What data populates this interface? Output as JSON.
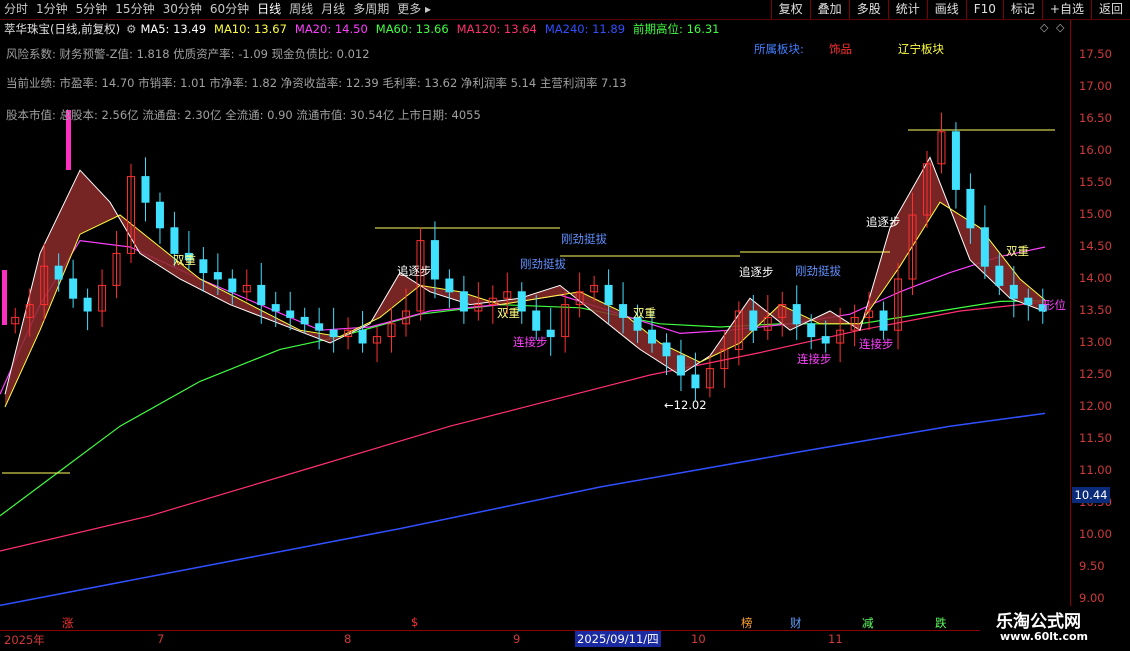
{
  "periods": [
    "分时",
    "1分钟",
    "5分钟",
    "15分钟",
    "30分钟",
    "60分钟",
    "日线",
    "周线",
    "月线",
    "多周期",
    "更多 ▸"
  ],
  "active_period": "日线",
  "tools": [
    "复权",
    "叠加",
    "多股",
    "统计",
    "画线",
    "F10",
    "标记",
    "+自选",
    "返回"
  ],
  "stock_title": "萃华珠宝(日线,前复权)",
  "ma": [
    {
      "label": "MA5: 13.49",
      "color": "#ffffff"
    },
    {
      "label": "MA10: 13.67",
      "color": "#ffff40"
    },
    {
      "label": "MA20: 14.50",
      "color": "#ff40ff"
    },
    {
      "label": "MA60: 13.66",
      "color": "#40ff40"
    },
    {
      "label": "MA120: 13.64",
      "color": "#ff3070"
    },
    {
      "label": "MA240: 11.89",
      "color": "#3050ff"
    },
    {
      "label": "前期高位: 16.31",
      "color": "#40ff40"
    }
  ],
  "info_lines": [
    "风险系数: 财务预警-Z值: 1.818 优质资产率: -1.09 现金负债比: 0.012",
    "当前业绩: 市盈率: 14.70 市销率: 1.01 市净率: 1.82 净资收益率: 12.39 毛利率: 13.62 净利润率 5.14 主营利润率 7.13",
    "股本市值: 总股本: 2.56亿 流通盘: 2.30亿 全流通: 0.90 流通市值: 30.54亿 上市日期: 4055"
  ],
  "sector_labels": [
    {
      "text": "所属板块:",
      "color": "#4080ff"
    },
    {
      "text": "饰品",
      "color": "#ff3030"
    },
    {
      "text": "辽宁板块",
      "color": "#ffff40"
    }
  ],
  "price_ticks": [
    "17.50",
    "17.00",
    "16.50",
    "16.00",
    "15.50",
    "15.00",
    "14.50",
    "14.00",
    "13.50",
    "13.00",
    "12.50",
    "12.00",
    "11.50",
    "11.00",
    "10.50",
    "10.00",
    "9.50",
    "9.00"
  ],
  "last_price": "10.44",
  "date_labels": [
    {
      "text": "2025年",
      "color": "#d03a3a"
    },
    {
      "text": "7",
      "color": "#d03a3a"
    },
    {
      "text": "8",
      "color": "#d03a3a"
    },
    {
      "text": "9",
      "color": "#d03a3a"
    },
    {
      "text": "10",
      "color": "#d03a3a"
    },
    {
      "text": "11",
      "color": "#d03a3a"
    }
  ],
  "selected_date": "2025/09/11/四",
  "bottom_marks": [
    {
      "text": "涨",
      "color": "#ff3030"
    },
    {
      "text": "$",
      "color": "#ff3030"
    },
    {
      "text": "榜",
      "color": "#ffa030"
    },
    {
      "text": "财",
      "color": "#60a0ff"
    },
    {
      "text": "减",
      "color": "#60ff60"
    },
    {
      "text": "跌",
      "color": "#60ff60"
    }
  ],
  "chart_annotations": [
    {
      "text": "双重",
      "color": "#ffff80"
    },
    {
      "text": "追逐步",
      "color": "#ffffff"
    },
    {
      "text": "刚劲挺拔",
      "color": "#6090ff"
    },
    {
      "text": "刚劲挺拔",
      "color": "#6090ff"
    },
    {
      "text": "双重",
      "color": "#ffff80"
    },
    {
      "text": "连接步",
      "color": "#ff40ff"
    },
    {
      "text": "双重",
      "color": "#ffff80"
    },
    {
      "text": "追逐步",
      "color": "#ffffff"
    },
    {
      "text": "刚劲挺拔",
      "color": "#6090ff"
    },
    {
      "text": "连接步",
      "color": "#ff40ff"
    },
    {
      "text": "追逐步",
      "color": "#ffffff"
    },
    {
      "text": "连接步",
      "color": "#ff40ff"
    },
    {
      "text": "双重",
      "color": "#ffff80"
    },
    {
      "text": "形位",
      "color": "#ff40ff"
    },
    {
      "text": "←12.02",
      "color": "#ffffff"
    }
  ],
  "watermark": {
    "line1": "乐淘公式网",
    "line2": "www.60lt.com"
  },
  "colors": {
    "bull": "#ff3030",
    "bear": "#40e0ff",
    "ma5": "#ffffff",
    "ma10": "#ffff40",
    "ma20": "#ff40ff",
    "ma60": "#40ff40",
    "ma120": "#ff3070",
    "ma240": "#3050ff"
  }
}
